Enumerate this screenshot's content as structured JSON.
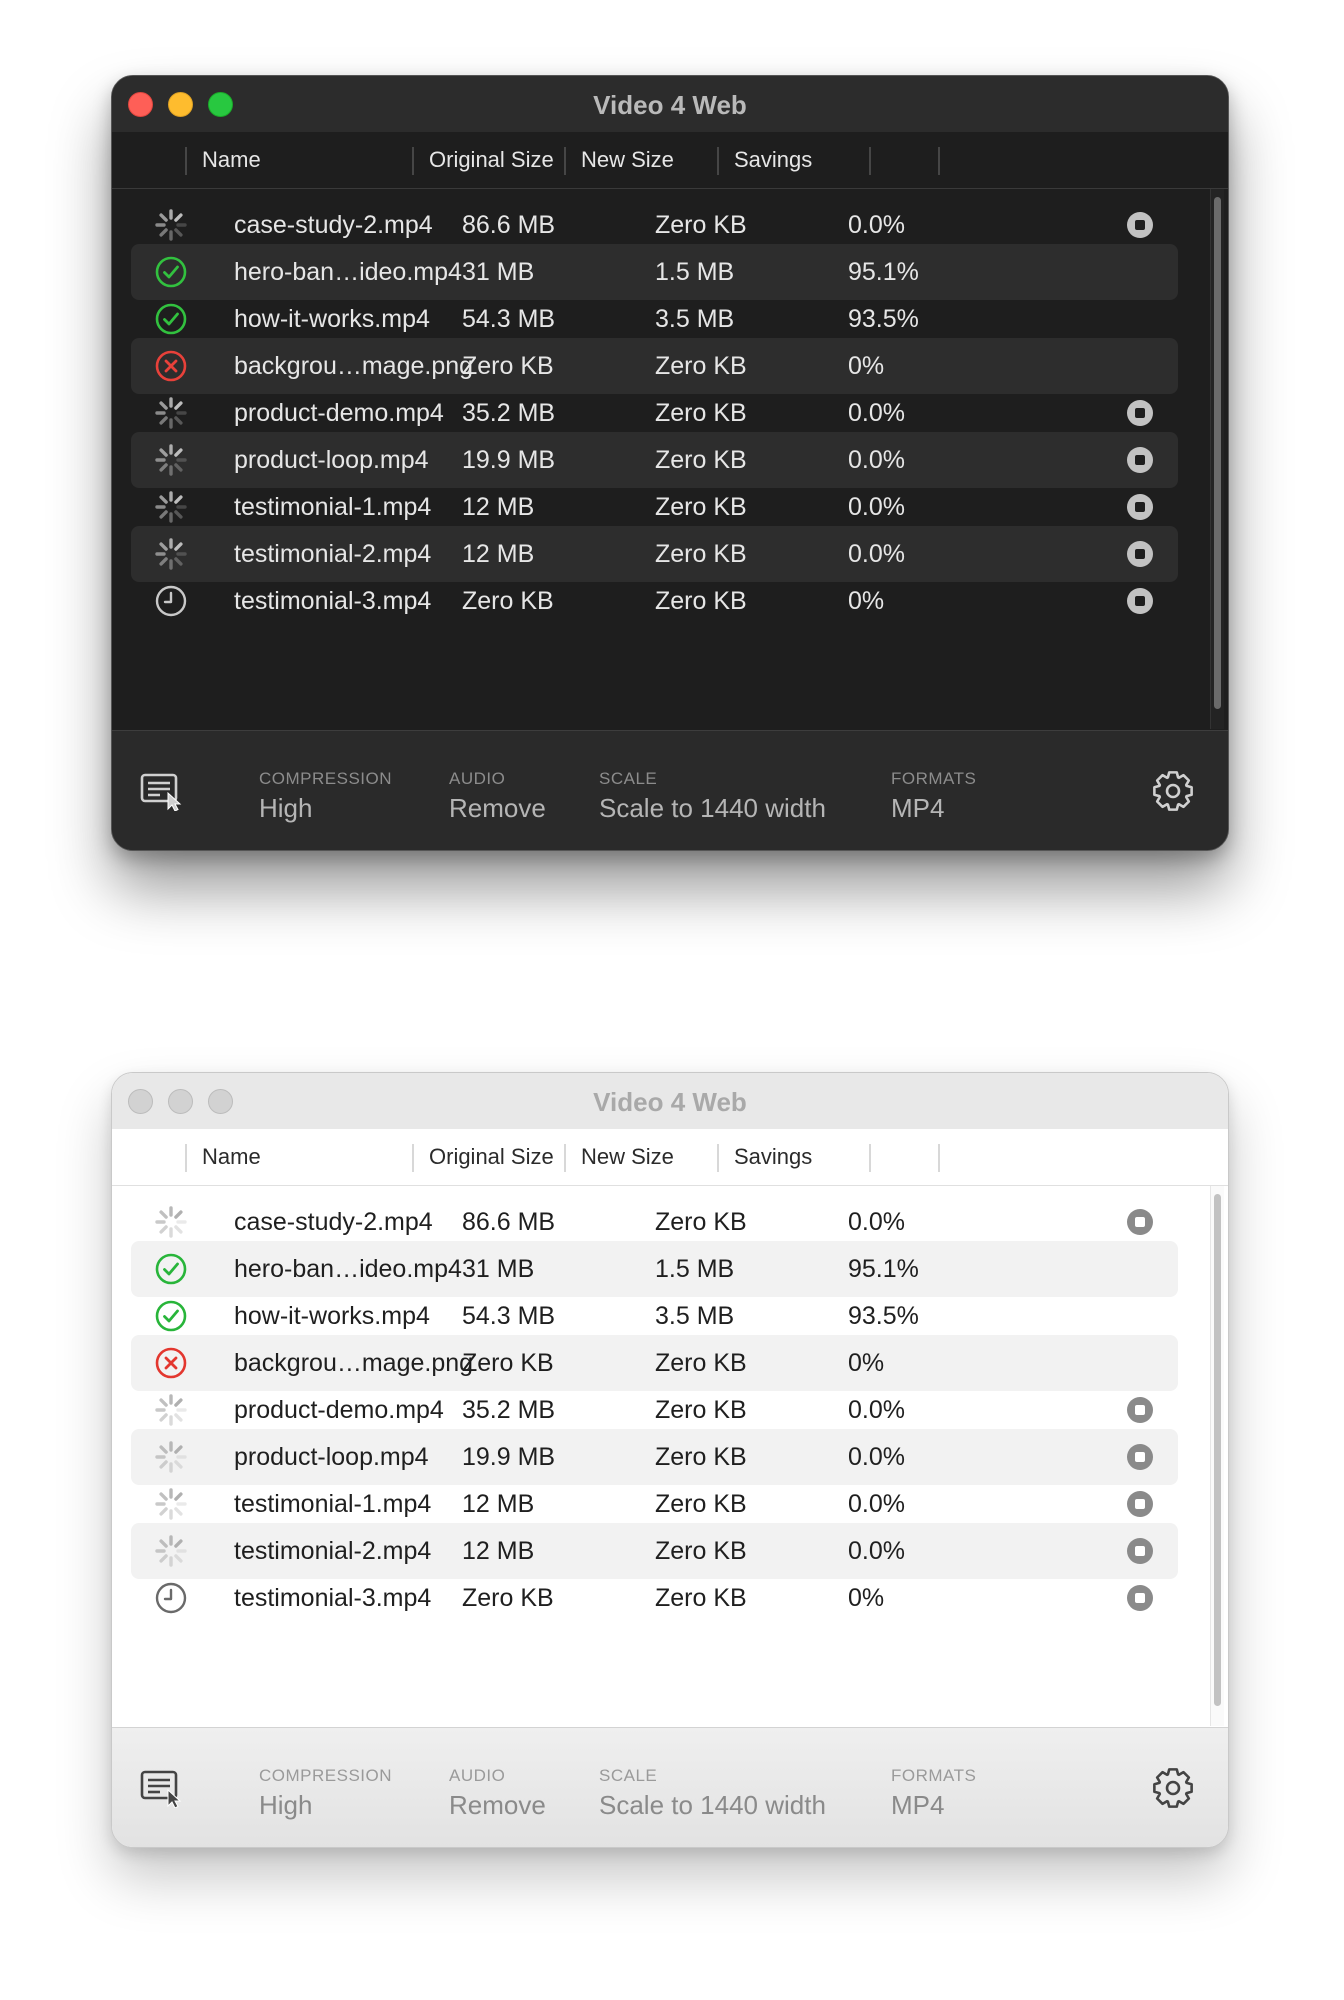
{
  "app": {
    "title": "Video 4 Web",
    "columns": [
      "Name",
      "Original Size",
      "New Size",
      "Savings"
    ],
    "files": [
      {
        "status": "spinner-icon",
        "name": "case-study-2.mp4",
        "original_size": "86.6 MB",
        "new_size": "Zero KB",
        "savings": "0.0%",
        "stoppable": true
      },
      {
        "status": "checkmark-circle-icon",
        "name": "hero-ban…ideo.mp4",
        "original_size": "31 MB",
        "new_size": "1.5 MB",
        "savings": "95.1%",
        "stoppable": false
      },
      {
        "status": "checkmark-circle-icon",
        "name": "how-it-works.mp4",
        "original_size": "54.3 MB",
        "new_size": "3.5 MB",
        "savings": "93.5%",
        "stoppable": false
      },
      {
        "status": "error-circle-icon",
        "name": "backgrou…mage.png",
        "original_size": "Zero KB",
        "new_size": "Zero KB",
        "savings": "0%",
        "stoppable": false
      },
      {
        "status": "spinner-icon",
        "name": "product-demo.mp4",
        "original_size": "35.2 MB",
        "new_size": "Zero KB",
        "savings": "0.0%",
        "stoppable": true
      },
      {
        "status": "spinner-icon",
        "name": "product-loop.mp4",
        "original_size": "19.9 MB",
        "new_size": "Zero KB",
        "savings": "0.0%",
        "stoppable": true
      },
      {
        "status": "spinner-icon",
        "name": "testimonial-1.mp4",
        "original_size": "12 MB",
        "new_size": "Zero KB",
        "savings": "0.0%",
        "stoppable": true
      },
      {
        "status": "spinner-icon",
        "name": "testimonial-2.mp4",
        "original_size": "12 MB",
        "new_size": "Zero KB",
        "savings": "0.0%",
        "stoppable": true
      },
      {
        "status": "clock-icon",
        "name": "testimonial-3.mp4",
        "original_size": "Zero KB",
        "new_size": "Zero KB",
        "savings": "0%",
        "stoppable": true
      }
    ],
    "settings": {
      "compression": {
        "label": "COMPRESSION",
        "value": "High"
      },
      "audio": {
        "label": "AUDIO",
        "value": "Remove"
      },
      "scale": {
        "label": "SCALE",
        "value": "Scale to 1440 width"
      },
      "formats": {
        "label": "FORMATS",
        "value": "MP4"
      }
    }
  },
  "themes": {
    "dark": {
      "success": "#32c13f",
      "error": "#e8413a",
      "spinner": "#bdbdbd",
      "clock": "#c8c8c8"
    },
    "light": {
      "success": "#28b53a",
      "error": "#e3372f",
      "spinner": "#b0b0b0",
      "clock": "#6a6a6a"
    }
  }
}
